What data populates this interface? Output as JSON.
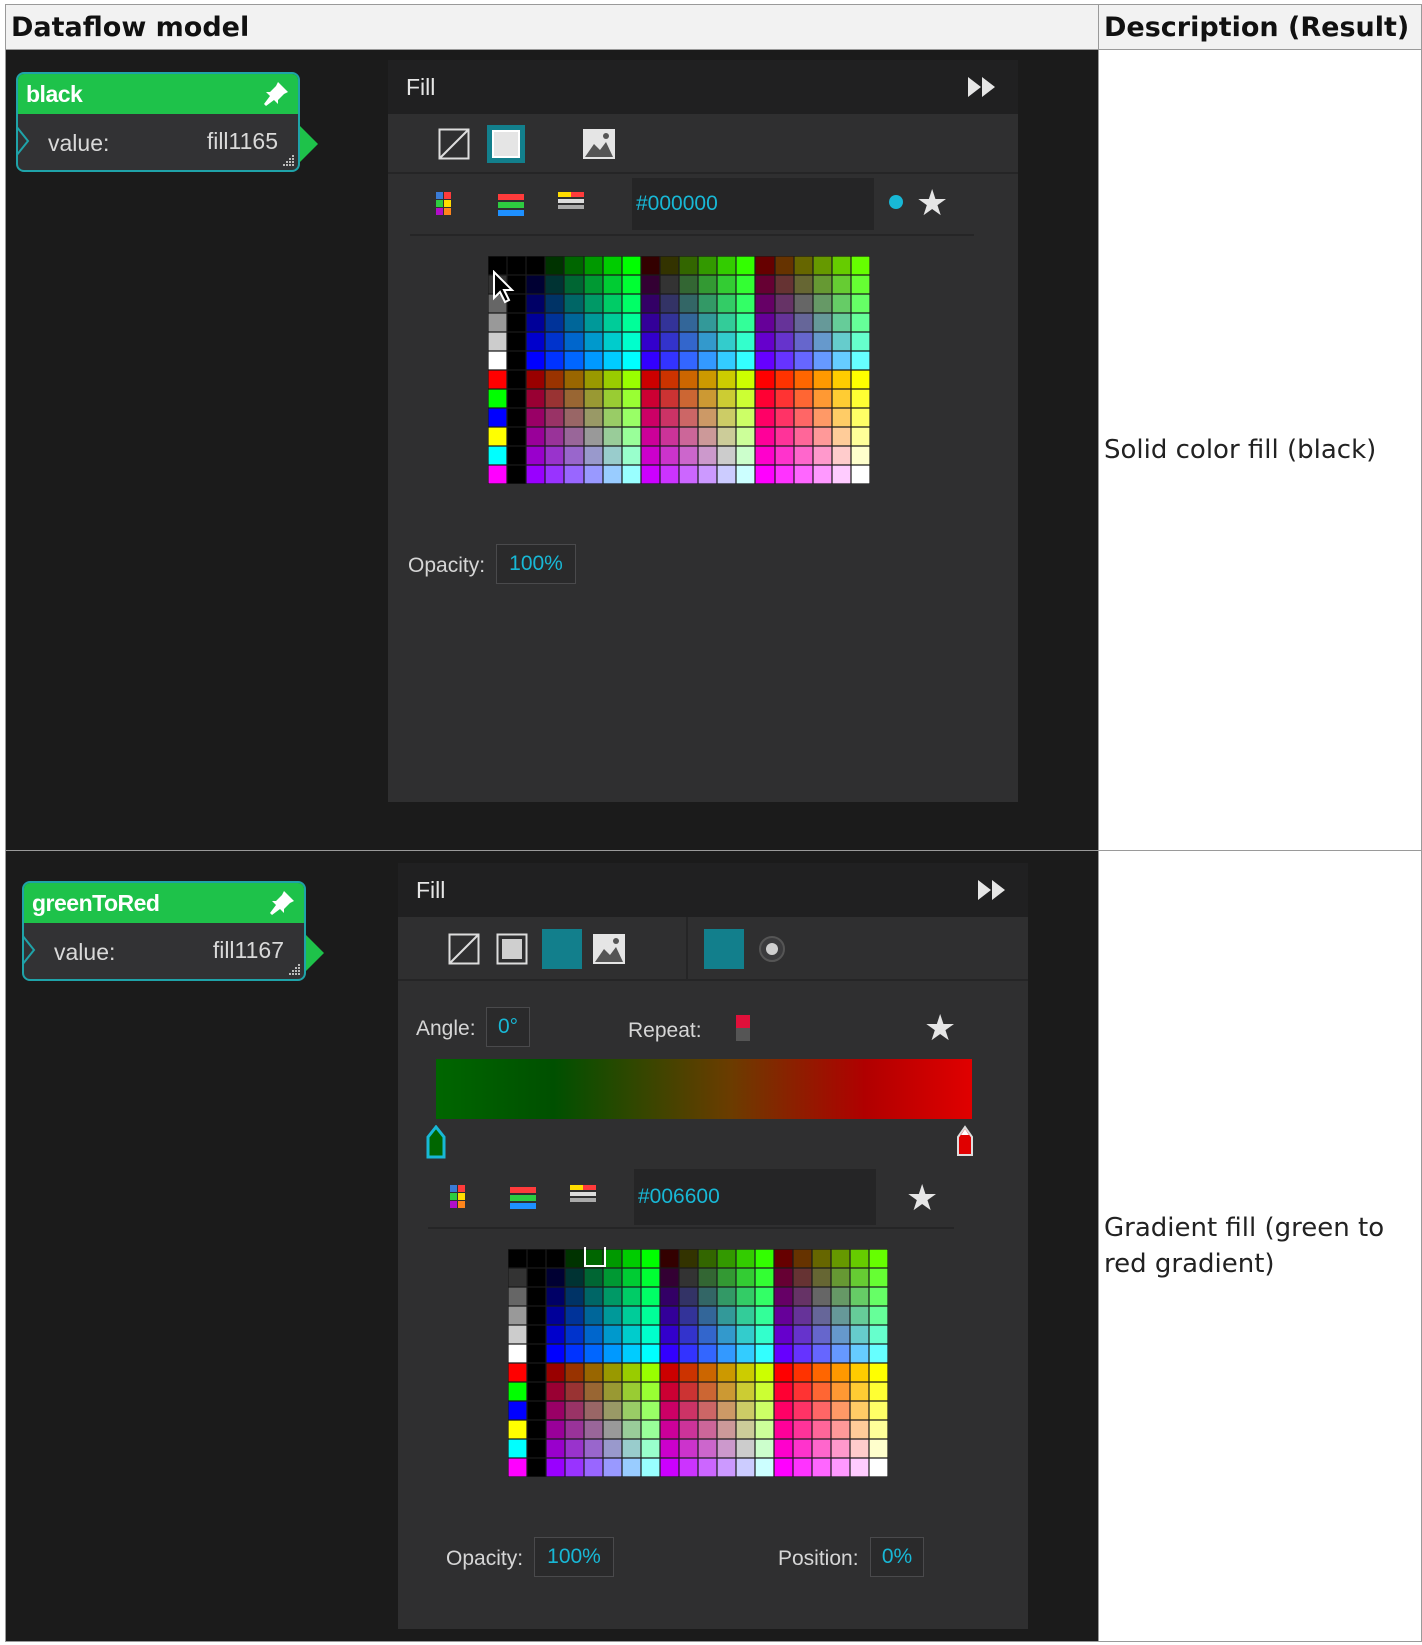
{
  "table": {
    "headers": [
      "Dataflow model",
      "Description (Result)"
    ]
  },
  "rows": [
    {
      "node": {
        "name": "black",
        "port_label": "value:",
        "port_value": "fill1165"
      },
      "panel": {
        "title": "Fill",
        "hex_value": "#000000",
        "opacity_label": "Opacity:",
        "opacity_value": "100%"
      },
      "description": "Solid color fill (black)"
    },
    {
      "node": {
        "name": "greenToRed",
        "port_label": "value:",
        "port_value": "fill1167"
      },
      "panel": {
        "title": "Fill",
        "angle_label": "Angle:",
        "angle_value": "0°",
        "repeat_label": "Repeat:",
        "hex_value": "#006600",
        "opacity_label": "Opacity:",
        "opacity_value": "100%",
        "position_label": "Position:",
        "position_value": "0%"
      },
      "description": "Gradient fill (green to red gradient)"
    }
  ],
  "colors": {
    "node_header": "#1ec24a",
    "node_border": "#1fa3a9",
    "accent_cyan": "#18b8d6",
    "panel_bg": "#2f2f30",
    "gradient_start": "#006600",
    "gradient_end": "#e00000"
  },
  "icons": [
    "pin-icon",
    "fast-forward-icon",
    "no-fill-icon",
    "solid-fill-icon",
    "gradient-fill-icon",
    "image-fill-icon",
    "swatches-icon",
    "sliders-icon",
    "palettes-icon",
    "star-icon",
    "radial-icon"
  ]
}
